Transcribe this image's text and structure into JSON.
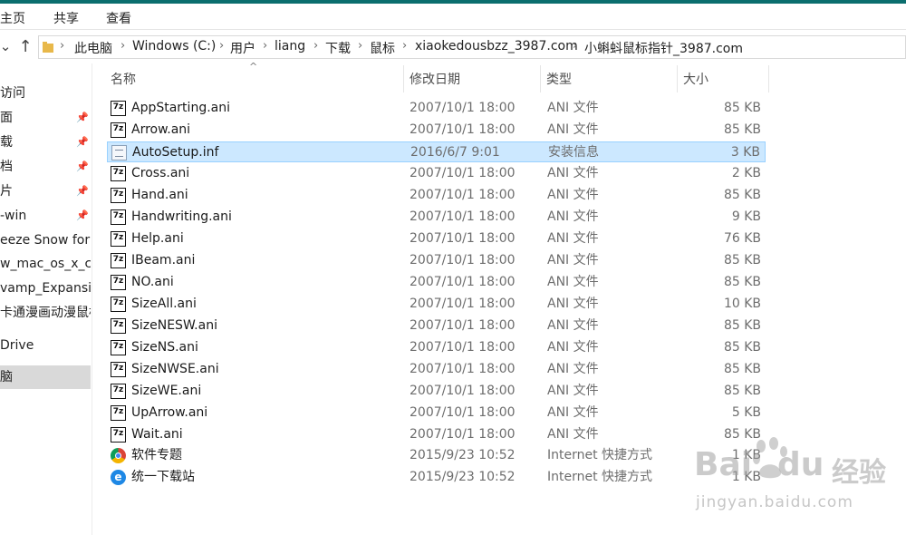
{
  "ribbon": {
    "tabs": [
      "主页",
      "共享",
      "查看"
    ]
  },
  "address": {
    "crumbs": [
      "此电脑",
      "Windows (C:)",
      "用户",
      "liang",
      "下载",
      "鼠标",
      "xiaokedousbzz_3987.com",
      "小蝌蚪鼠标指针_3987.com"
    ]
  },
  "nav": {
    "items": [
      {
        "label": "访问",
        "pinned": false
      },
      {
        "label": "面",
        "pinned": true
      },
      {
        "label": "载",
        "pinned": true
      },
      {
        "label": "档",
        "pinned": true
      },
      {
        "label": "片",
        "pinned": true
      },
      {
        "label": "-win",
        "pinned": true
      },
      {
        "label": "eeze Snow for W",
        "pinned": false
      },
      {
        "label": "w_mac_os_x_cur",
        "pinned": false
      },
      {
        "label": "vamp_Expansion",
        "pinned": false
      },
      {
        "label": "卡通漫画动漫鼠标指",
        "pinned": false
      },
      {
        "label": "Drive",
        "pinned": false
      },
      {
        "label": "脑",
        "pinned": false,
        "selected": true
      }
    ]
  },
  "columns": {
    "name": "名称",
    "date": "修改日期",
    "type": "类型",
    "size": "大小"
  },
  "files": [
    {
      "name": "AppStarting.ani",
      "date": "2007/10/1 18:00",
      "type": "ANI 文件",
      "size": "85 KB",
      "icon": "7z"
    },
    {
      "name": "Arrow.ani",
      "date": "2007/10/1 18:00",
      "type": "ANI 文件",
      "size": "85 KB",
      "icon": "7z"
    },
    {
      "name": "AutoSetup.inf",
      "date": "2016/6/7 9:01",
      "type": "安装信息",
      "size": "3 KB",
      "icon": "inf",
      "selected": true
    },
    {
      "name": "Cross.ani",
      "date": "2007/10/1 18:00",
      "type": "ANI 文件",
      "size": "2 KB",
      "icon": "7z"
    },
    {
      "name": "Hand.ani",
      "date": "2007/10/1 18:00",
      "type": "ANI 文件",
      "size": "85 KB",
      "icon": "7z"
    },
    {
      "name": "Handwriting.ani",
      "date": "2007/10/1 18:00",
      "type": "ANI 文件",
      "size": "9 KB",
      "icon": "7z"
    },
    {
      "name": "Help.ani",
      "date": "2007/10/1 18:00",
      "type": "ANI 文件",
      "size": "76 KB",
      "icon": "7z"
    },
    {
      "name": "IBeam.ani",
      "date": "2007/10/1 18:00",
      "type": "ANI 文件",
      "size": "85 KB",
      "icon": "7z"
    },
    {
      "name": "NO.ani",
      "date": "2007/10/1 18:00",
      "type": "ANI 文件",
      "size": "85 KB",
      "icon": "7z"
    },
    {
      "name": "SizeAll.ani",
      "date": "2007/10/1 18:00",
      "type": "ANI 文件",
      "size": "10 KB",
      "icon": "7z"
    },
    {
      "name": "SizeNESW.ani",
      "date": "2007/10/1 18:00",
      "type": "ANI 文件",
      "size": "85 KB",
      "icon": "7z"
    },
    {
      "name": "SizeNS.ani",
      "date": "2007/10/1 18:00",
      "type": "ANI 文件",
      "size": "85 KB",
      "icon": "7z"
    },
    {
      "name": "SizeNWSE.ani",
      "date": "2007/10/1 18:00",
      "type": "ANI 文件",
      "size": "85 KB",
      "icon": "7z"
    },
    {
      "name": "SizeWE.ani",
      "date": "2007/10/1 18:00",
      "type": "ANI 文件",
      "size": "85 KB",
      "icon": "7z"
    },
    {
      "name": "UpArrow.ani",
      "date": "2007/10/1 18:00",
      "type": "ANI 文件",
      "size": "5 KB",
      "icon": "7z"
    },
    {
      "name": "Wait.ani",
      "date": "2007/10/1 18:00",
      "type": "ANI 文件",
      "size": "85 KB",
      "icon": "7z"
    },
    {
      "name": "软件专题",
      "date": "2015/9/23 10:52",
      "type": "Internet 快捷方式",
      "size": "1 KB",
      "icon": "chrome"
    },
    {
      "name": "统一下载站",
      "date": "2015/9/23 10:52",
      "type": "Internet 快捷方式",
      "size": "1 KB",
      "icon": "ie"
    }
  ],
  "watermark": {
    "brand_a": "Bai",
    "brand_b": "du",
    "brand_cn": "经验",
    "url": "jingyan.baidu.com"
  },
  "colors": {
    "accent_stripe": "#0b6e6e",
    "selection_bg": "#cce8ff",
    "selection_border": "#99d1ff",
    "nav_selected": "#d9d9d9"
  }
}
